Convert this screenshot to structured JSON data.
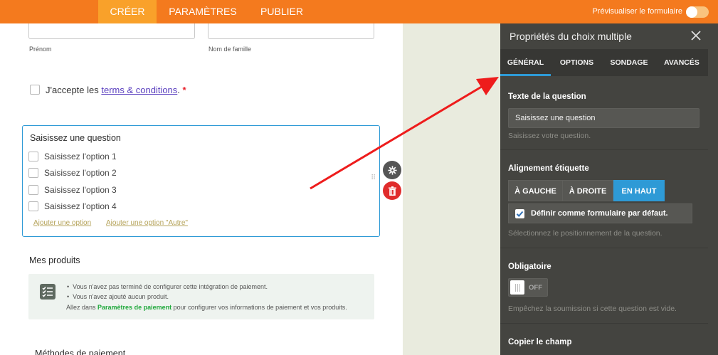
{
  "topbar": {
    "tabs": [
      {
        "label": "CRÉER",
        "active": true
      },
      {
        "label": "PARAMÈTRES",
        "active": false
      },
      {
        "label": "PUBLIER",
        "active": false
      }
    ],
    "preview_label": "Prévisualiser le formulaire",
    "accent": "#f47a1e"
  },
  "form": {
    "first_name_label": "Prénom",
    "last_name_label": "Nom de famille",
    "terms": {
      "prefix": "J'accepte les ",
      "link": "terms & conditions",
      "suffix": ".",
      "required_mark": "*"
    },
    "question": {
      "title": "Saisissez une question",
      "options": [
        "Saisissez l'option 1",
        "Saisissez l'option 2",
        "Saisissez l'option 3",
        "Saisissez l'option 4"
      ],
      "add_option": "Ajouter une option",
      "add_other": "Ajouter une option \"Autre\""
    },
    "products": {
      "title": "Mes produits",
      "notice_1": "Vous n'avez pas terminé de configurer cette intégration de paiement.",
      "notice_2": "Vous n'avez ajouté aucun produit.",
      "hint_prefix": "Allez dans ",
      "hint_link": "Paramètres de paiement",
      "hint_suffix": " pour configurer vos informations de paiement et vos produits."
    },
    "payment_methods_title": "Méthodes de paiement"
  },
  "panel": {
    "title": "Propriétés du choix multiple",
    "tabs": [
      {
        "label": "GÉNÉRAL",
        "active": true
      },
      {
        "label": "OPTIONS",
        "active": false
      },
      {
        "label": "SONDAGE",
        "active": false
      },
      {
        "label": "AVANCÉS",
        "active": false
      }
    ],
    "question_text": {
      "title": "Texte de la question",
      "value": "Saisissez une question",
      "help": "Saisissez votre question."
    },
    "alignment": {
      "title": "Alignement étiquette",
      "buttons": [
        {
          "label": "À GAUCHE",
          "active": false
        },
        {
          "label": "À DROITE",
          "active": false
        },
        {
          "label": "EN HAUT",
          "active": true
        }
      ],
      "default_label": "Définir comme formulaire par défaut.",
      "default_checked": true,
      "help": "Sélectionnez le positionnement de la question."
    },
    "required": {
      "title": "Obligatoire",
      "state": "OFF",
      "help": "Empêchez la soumission si cette question est vide."
    },
    "copy_field_title": "Copier le champ"
  },
  "icons": [
    "gear-icon",
    "trash-icon",
    "close-icon",
    "checklist-icon",
    "drag-handle-icon",
    "check-icon"
  ]
}
